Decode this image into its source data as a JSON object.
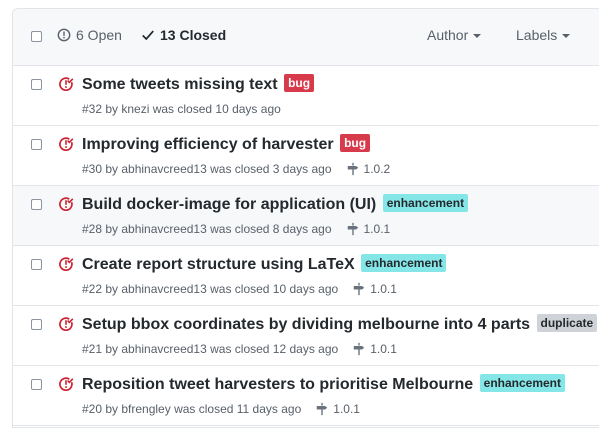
{
  "header": {
    "open_label": "6 Open",
    "closed_label": "13 Closed",
    "author_label": "Author",
    "labels_label": "Labels"
  },
  "issues": [
    {
      "title": "Some tweets missing text",
      "label": "bug",
      "label_color": "#d73a4a",
      "label_text_color": "#ffffff",
      "meta": "#32 by knezi was closed 10 days ago",
      "milestone": "",
      "highlighted": false
    },
    {
      "title": "Improving efficiency of harvester",
      "label": "bug",
      "label_color": "#d73a4a",
      "label_text_color": "#ffffff",
      "meta": "#30 by abhinavcreed13 was closed 3 days ago",
      "milestone": "1.0.2",
      "highlighted": false
    },
    {
      "title": "Build docker-image for application (UI)",
      "label": "enhancement",
      "label_color": "#84e6e6",
      "label_text_color": "#24292e",
      "meta": "#28 by abhinavcreed13 was closed 8 days ago",
      "milestone": "1.0.1",
      "highlighted": true
    },
    {
      "title": "Create report structure using LaTeX",
      "label": "enhancement",
      "label_color": "#84e6e6",
      "label_text_color": "#24292e",
      "meta": "#22 by abhinavcreed13 was closed 10 days ago",
      "milestone": "1.0.1",
      "highlighted": false
    },
    {
      "title": "Setup bbox coordinates by dividing melbourne into 4 parts",
      "label": "duplicate",
      "label_color": "#cfd3d7",
      "label_text_color": "#24292e",
      "meta": "#21 by abhinavcreed13 was closed 12 days ago",
      "milestone": "1.0.1",
      "highlighted": false
    },
    {
      "title": "Reposition tweet harvesters to prioritise Melbourne",
      "label": "enhancement",
      "label_color": "#84e6e6",
      "label_text_color": "#24292e",
      "meta": "#20 by bfrengley was closed 11 days ago",
      "milestone": "1.0.1",
      "highlighted": false
    }
  ],
  "colors": {
    "closed_issue_icon": "#cb2431",
    "milestone_icon": "#6a737d"
  }
}
